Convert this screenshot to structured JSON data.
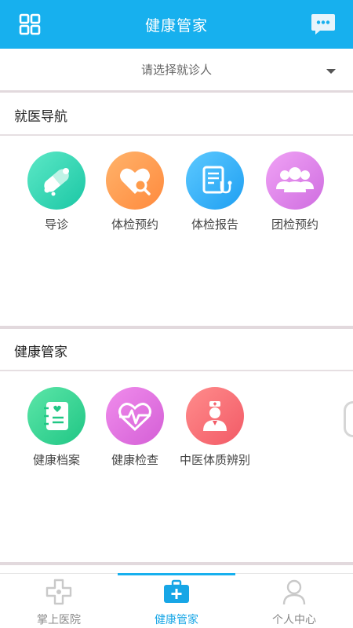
{
  "header": {
    "title": "健康管家",
    "left_icon": "grid-icon",
    "right_icon": "message-icon"
  },
  "patient_select": {
    "placeholder": "请选择就诊人"
  },
  "sections": [
    {
      "title": "就医导航",
      "items": [
        {
          "label": "导诊",
          "icon": "pills-icon",
          "color": "#1bc7a5"
        },
        {
          "label": "体检预约",
          "icon": "heart-search-icon",
          "color": "#ff8a3d"
        },
        {
          "label": "体检报告",
          "icon": "report-stethoscope-icon",
          "color": "#1f9ff2"
        },
        {
          "label": "团检预约",
          "icon": "group-icon",
          "color": "#cf6de0"
        }
      ]
    },
    {
      "title": "健康管家",
      "items": [
        {
          "label": "健康档案",
          "icon": "health-record-icon",
          "color": "#20c685"
        },
        {
          "label": "健康检查",
          "icon": "heartbeat-icon",
          "color": "#d45fd6"
        },
        {
          "label": "中医体质辨别",
          "icon": "doctor-icon",
          "color": "#f25a66"
        }
      ]
    }
  ],
  "tabbar": {
    "active": 1,
    "tabs": [
      {
        "label": "掌上医院",
        "icon": "hospital-cross-icon"
      },
      {
        "label": "健康管家",
        "icon": "medical-kit-icon"
      },
      {
        "label": "个人中心",
        "icon": "person-icon"
      }
    ]
  },
  "colors": {
    "accent": "#17b0ee",
    "active_tab": "#17a6e6"
  }
}
